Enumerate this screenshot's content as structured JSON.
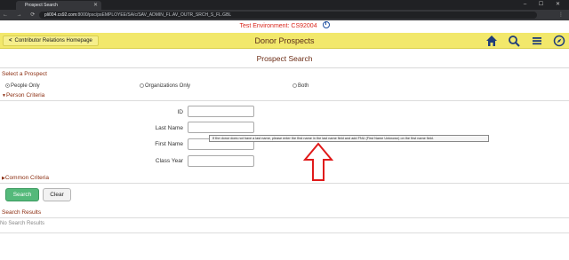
{
  "browser": {
    "tab_title": "Prospect Search",
    "url_host": "pli004.cs92.com",
    "url_path": ":8000/psc/psEMPLOYEE/SA/c/SAV_ADMIN_FL.AV_OUTR_SRCH_S_FL.GBL"
  },
  "environment": {
    "text": "Test Environment: CS92004"
  },
  "header": {
    "back_link": "Contributor Relations Homepage",
    "title": "Donor Prospects",
    "icons": [
      "home-icon",
      "search-icon",
      "menu-icon",
      "navbar-icon"
    ],
    "accent_color": "#f2e86b"
  },
  "page": {
    "title": "Prospect Search"
  },
  "prospect_type": {
    "label": "Select a Prospect",
    "options": [
      {
        "label": "People Only",
        "selected": true
      },
      {
        "label": "Organizations Only",
        "selected": false
      },
      {
        "label": "Both",
        "selected": false
      }
    ]
  },
  "person_criteria": {
    "label": "Person Criteria",
    "fields": [
      {
        "label": "ID",
        "value": ""
      },
      {
        "label": "Last Name",
        "value": ""
      },
      {
        "label": "First Name",
        "value": ""
      },
      {
        "label": "Class Year",
        "value": ""
      }
    ],
    "tooltip": "If the donor does not have a last name, please enter the first name in the last name field and add FNU (First Name Unknown) on the first name field."
  },
  "common_criteria": {
    "label": "Common Criteria"
  },
  "buttons": {
    "search": "Search",
    "clear": "Clear"
  },
  "results": {
    "label": "Search Results",
    "empty_text": "No Search Results"
  }
}
